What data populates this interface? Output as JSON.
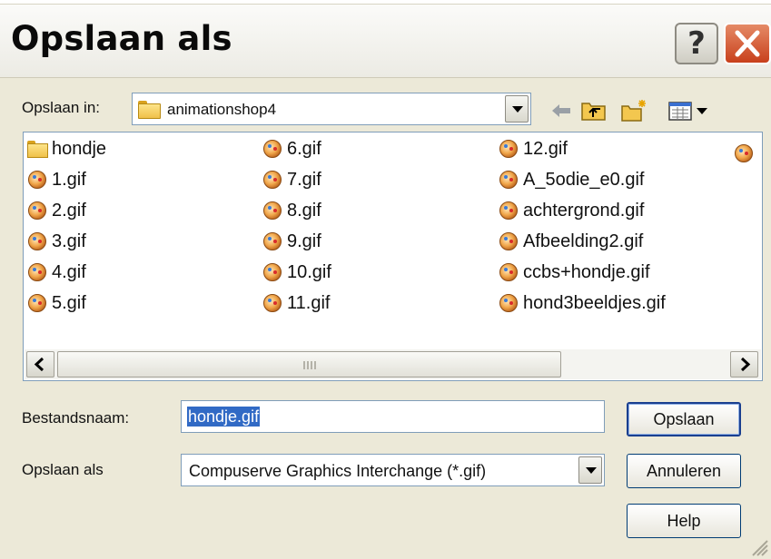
{
  "dialog": {
    "title": "Opslaan als",
    "help_glyph": "?",
    "close_icon": "close-icon"
  },
  "location": {
    "label": "Opslaan in:",
    "value": "animationshop4"
  },
  "toolbar": {
    "icons": [
      "back-arrow-icon",
      "up-folder-icon",
      "new-folder-icon",
      "view-menu-icon"
    ]
  },
  "files": {
    "columns": [
      [
        {
          "name": "hondje",
          "type": "folder"
        },
        {
          "name": "1.gif",
          "type": "gif"
        },
        {
          "name": "2.gif",
          "type": "gif"
        },
        {
          "name": "3.gif",
          "type": "gif"
        },
        {
          "name": "4.gif",
          "type": "gif"
        },
        {
          "name": "5.gif",
          "type": "gif"
        }
      ],
      [
        {
          "name": "6.gif",
          "type": "gif"
        },
        {
          "name": "7.gif",
          "type": "gif"
        },
        {
          "name": "8.gif",
          "type": "gif"
        },
        {
          "name": "9.gif",
          "type": "gif"
        },
        {
          "name": "10.gif",
          "type": "gif"
        },
        {
          "name": "11.gif",
          "type": "gif"
        }
      ],
      [
        {
          "name": "12.gif",
          "type": "gif"
        },
        {
          "name": "A_5odie_e0.gif",
          "type": "gif"
        },
        {
          "name": "achtergrond.gif",
          "type": "gif"
        },
        {
          "name": "Afbeelding2.gif",
          "type": "gif"
        },
        {
          "name": "ccbs+hondje.gif",
          "type": "gif"
        },
        {
          "name": "hond3beeldjes.gif",
          "type": "gif"
        }
      ]
    ]
  },
  "filename": {
    "label": "Bestandsnaam:",
    "value": "hondje.gif"
  },
  "filetype": {
    "label": "Opslaan als",
    "value": "Compuserve Graphics Interchange (*.gif)"
  },
  "buttons": {
    "save": "Opslaan",
    "cancel": "Annuleren",
    "help": "Help"
  },
  "colors": {
    "selection": "#316ac5",
    "window_bg": "#ece9d8",
    "close_button": "#c8401c"
  }
}
